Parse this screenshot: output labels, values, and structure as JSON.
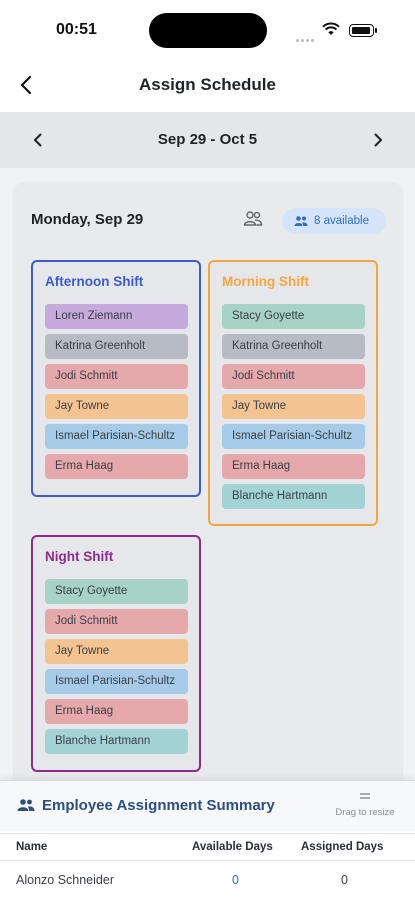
{
  "status_bar": {
    "time": "00:51"
  },
  "header": {
    "title": "Assign Schedule"
  },
  "week": {
    "range": "Sep 29 - Oct 5"
  },
  "day": {
    "title": "Monday, Sep 29",
    "available_label": "8 available"
  },
  "shifts": {
    "afternoon": {
      "title": "Afternoon Shift",
      "color": "#3b5bd6",
      "employees": [
        "Loren Ziemann",
        "Katrina Greenholt",
        "Jodi Schmitt",
        "Jay Towne",
        "Ismael Parisian-Schultz",
        "Erma Haag"
      ]
    },
    "morning": {
      "title": "Morning Shift",
      "color": "#f5a640",
      "employees": [
        "Stacy Goyette",
        "Katrina Greenholt",
        "Jodi Schmitt",
        "Jay Towne",
        "Ismael Parisian-Schultz",
        "Erma Haag",
        "Blanche Hartmann"
      ]
    },
    "night": {
      "title": "Night Shift",
      "color": "#8e2b8e",
      "employees": [
        "Stacy Goyette",
        "Jodi Schmitt",
        "Jay Towne",
        "Ismael Parisian-Schultz",
        "Erma Haag",
        "Blanche Hartmann"
      ]
    }
  },
  "summary": {
    "title": "Employee Assignment Summary",
    "drag_hint": "Drag to resize",
    "columns": {
      "name": "Name",
      "available": "Available Days",
      "assigned": "Assigned Days"
    },
    "rows": [
      {
        "name": "Alonzo Schneider",
        "available": "0",
        "assigned": "0"
      }
    ]
  }
}
